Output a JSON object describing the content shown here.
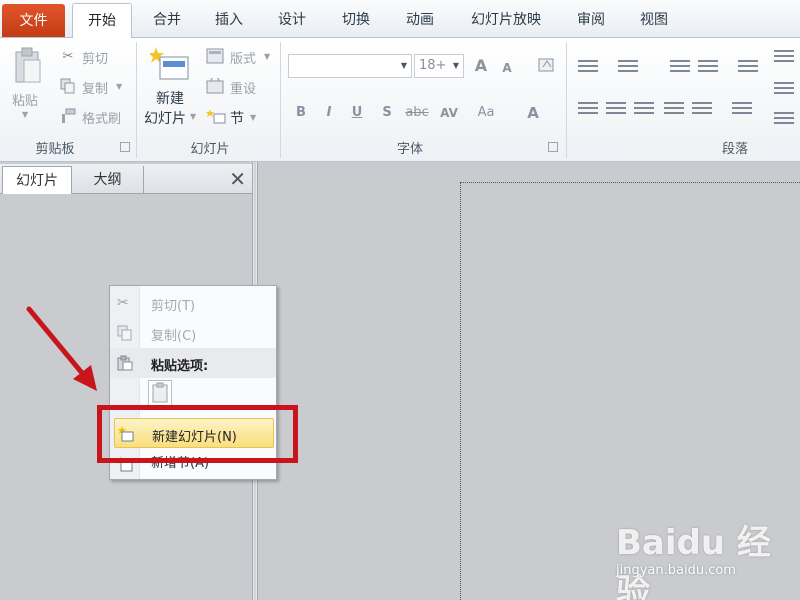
{
  "tabs": {
    "file": "文件",
    "home": "开始",
    "merge": "合并",
    "insert": "插入",
    "design": "设计",
    "transitions": "切换",
    "animations": "动画",
    "slideshow": "幻灯片放映",
    "review": "审阅",
    "view": "视图"
  },
  "clipboard": {
    "paste": "粘贴",
    "cut": "剪切",
    "copy": "复制",
    "format_painter": "格式刷",
    "group_label": "剪贴板"
  },
  "slides": {
    "new_slide_line1": "新建",
    "new_slide_line2": "幻灯片",
    "layout": "版式",
    "reset": "重设",
    "section": "节",
    "group_label": "幻灯片"
  },
  "font": {
    "font_name": "",
    "font_size": "18+",
    "group_label": "字体",
    "grow": "A",
    "shrink": "A",
    "bold": "B",
    "italic": "I",
    "underline": "U",
    "shadow": "S",
    "strike": "abc",
    "spacing": "AV",
    "case": "Aa",
    "color": "A"
  },
  "paragraph": {
    "group_label": "段落"
  },
  "panel": {
    "tab_slides": "幻灯片",
    "tab_outline": "大纲",
    "close": "✕"
  },
  "context_menu": {
    "cut": "剪切(T)",
    "copy": "复制(C)",
    "paste_options": "粘贴选项:",
    "new_slide": "新建幻灯片(N)",
    "new_section": "新增节(A)"
  },
  "watermark": {
    "brand": "Baidu 经验",
    "url": "jingyan.baidu.com"
  },
  "colors": {
    "file_tab": "#d9491f",
    "highlight": "#f9df7c",
    "annotation_red": "#c8151b"
  }
}
